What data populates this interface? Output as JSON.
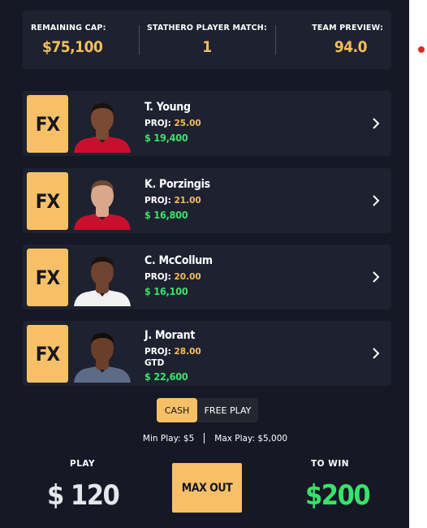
{
  "stats": {
    "remaining_cap": {
      "label": "REMAINING CAP:",
      "value": "$75,100"
    },
    "player_match": {
      "label": "STATHERO PLAYER MATCH:",
      "value": "1"
    },
    "team_preview": {
      "label": "TEAM PREVIEW:",
      "value": "94.0"
    }
  },
  "players": [
    {
      "badge": "FX",
      "name": "T. Young",
      "proj_label": "PROJ:",
      "proj": "25.00",
      "status": "",
      "salary": "$ 19,400",
      "jersey": "#c8102e",
      "skin": "#7a4a32",
      "hair": "#1a120d"
    },
    {
      "badge": "FX",
      "name": "K. Porzingis",
      "proj_label": "PROJ:",
      "proj": "21.00",
      "status": "",
      "salary": "$ 16,800",
      "jersey": "#c8102e",
      "skin": "#d9a88a",
      "hair": "#6b4a32"
    },
    {
      "badge": "FX",
      "name": "C. McCollum",
      "proj_label": "PROJ:",
      "proj": "20.00",
      "status": "",
      "salary": "$ 16,100",
      "jersey": "#f2f2f2",
      "skin": "#6e4430",
      "hair": "#1a120d"
    },
    {
      "badge": "FX",
      "name": "J. Morant",
      "proj_label": "PROJ:",
      "proj": "28.00",
      "status": "GTD",
      "salary": "$ 22,600",
      "jersey": "#5d6b86",
      "skin": "#6a3f2a",
      "hair": "#120c08"
    }
  ],
  "toggle": {
    "cash": "CASH",
    "free_play": "FREE PLAY"
  },
  "limits": {
    "min": "Min Play: $5",
    "max": "Max Play: $5,000"
  },
  "bottom": {
    "play_label": "PLAY",
    "play_amount": "$ 120",
    "max_out": "MAX OUT",
    "win_label": "TO WIN",
    "win_amount": "$200"
  },
  "colors": {
    "accent": "#f7c068",
    "green": "#39e36a",
    "background": "#161826",
    "card": "#1e2130"
  },
  "icons": {
    "card_arrow": "chevron-right-icon",
    "notification": "red-dot-icon"
  }
}
